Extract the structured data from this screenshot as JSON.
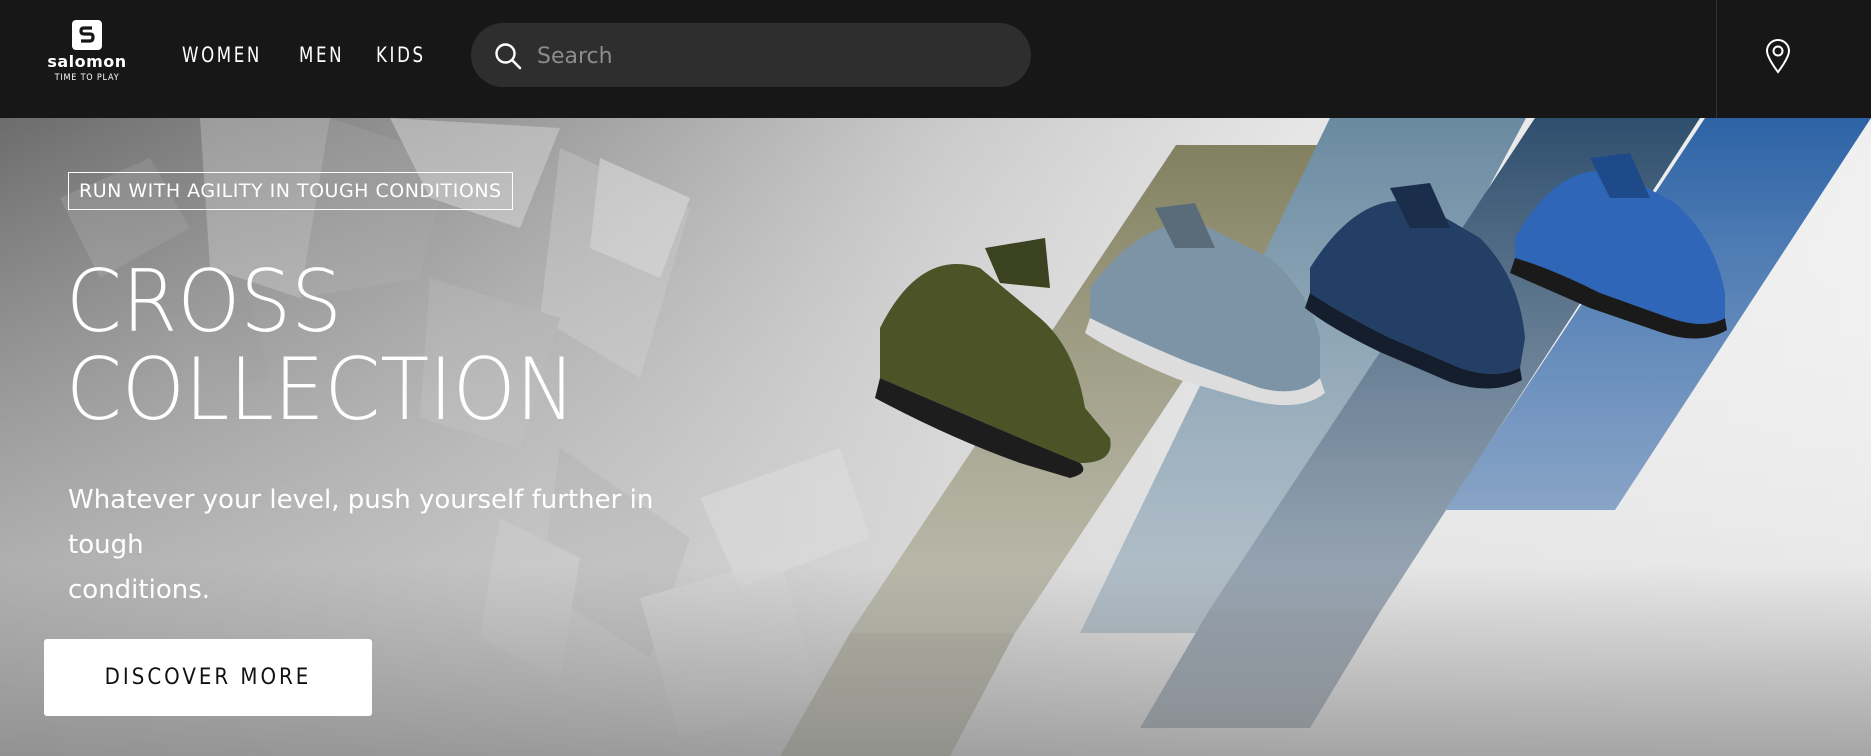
{
  "brand": {
    "name": "salomon",
    "tagline": "TIME TO PLAY"
  },
  "nav": {
    "items": [
      {
        "label": "WOMEN"
      },
      {
        "label": "MEN"
      },
      {
        "label": "KIDS"
      }
    ]
  },
  "search": {
    "placeholder": "Search",
    "icon": "search-icon"
  },
  "header_actions": {
    "location_icon": "location-pin-icon"
  },
  "hero": {
    "eyebrow": "RUN WITH AGILITY IN TOUGH CONDITIONS",
    "headline_line1": "CROSS",
    "headline_line2": "COLLECTION",
    "subtext_line1": "Whatever your level, push yourself further in tough",
    "subtext_line2": "conditions.",
    "cta_label": "DISCOVER MORE",
    "stripe_colors": [
      "#7e7c5a",
      "#5d7c92",
      "#2f4e6c",
      "#2f62a3"
    ],
    "shoe_colors": [
      "#4b5327",
      "#7c94a6",
      "#243f66",
      "#2f66b8"
    ]
  }
}
